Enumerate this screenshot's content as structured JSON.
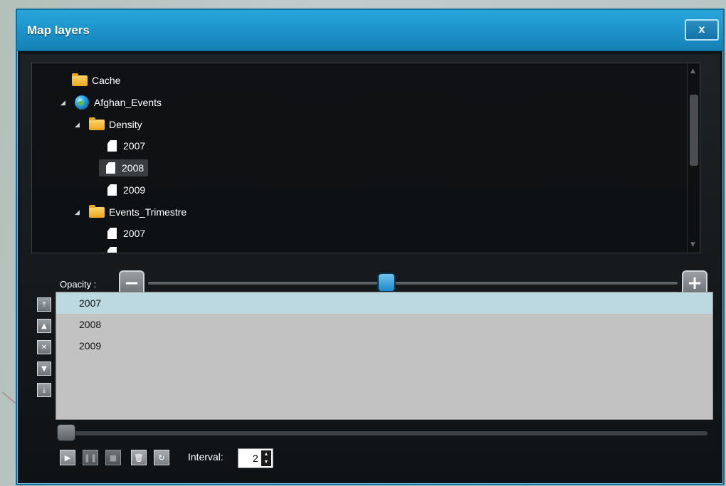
{
  "window": {
    "title": "Map layers",
    "close_label": "x"
  },
  "tree": {
    "items": [
      {
        "label": "Cache",
        "icon": "folder-icon",
        "level": 1,
        "expanded": null
      },
      {
        "label": "Afghan_Events",
        "icon": "globe-icon",
        "level": 0,
        "expanded": true
      },
      {
        "label": "Density",
        "icon": "folder-icon",
        "level": 1,
        "expanded": true
      },
      {
        "label": "2007",
        "icon": "document-icon",
        "level": 2
      },
      {
        "label": "2008",
        "icon": "document-icon",
        "level": 2,
        "selected": true
      },
      {
        "label": "2009",
        "icon": "document-icon",
        "level": 2
      },
      {
        "label": "Events_Trimestre",
        "icon": "folder-icon",
        "level": 1,
        "expanded": true
      },
      {
        "label": "2007",
        "icon": "document-icon",
        "level": 2
      }
    ]
  },
  "opacity": {
    "label": "Opacity :",
    "value_fraction": 0.45,
    "minus": "−",
    "plus": "+"
  },
  "time_list": {
    "items": [
      "2007",
      "2008",
      "2009"
    ],
    "active_index": 0,
    "side_controls": [
      "move-top",
      "move-up",
      "remove",
      "move-down",
      "move-bottom"
    ]
  },
  "timeline": {
    "position_fraction": 0.0
  },
  "playback": {
    "interval_label": "Interval:",
    "interval_value": "2",
    "buttons": [
      "play",
      "pause",
      "stop",
      "delete",
      "refresh"
    ]
  },
  "colors": {
    "title_bar": "#1a92c9",
    "accent": "#2aa0de",
    "list_bg": "#c2c2c2",
    "active_row": "#bcd8e0"
  }
}
